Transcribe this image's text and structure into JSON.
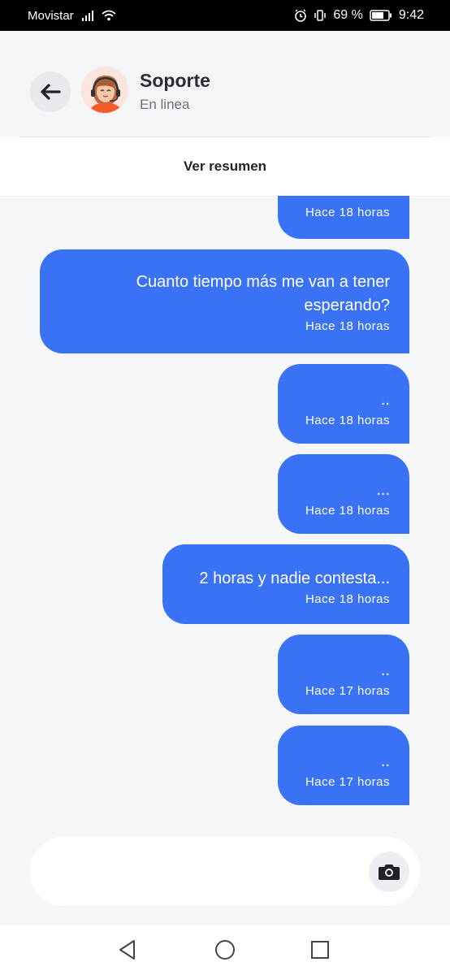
{
  "status_bar": {
    "carrier": "Movistar",
    "battery": "69 %",
    "time": "9:42"
  },
  "header": {
    "contact_name": "Soporte",
    "contact_status": "En linea",
    "summary_label": "Ver resumen"
  },
  "messages": [
    {
      "text": "",
      "time": "Hace 18 horas"
    },
    {
      "text": "Cuanto tiempo más me van a tener esperando?",
      "time": "Hace 18 horas"
    },
    {
      "text": "..",
      "time": "Hace 18 horas"
    },
    {
      "text": "...",
      "time": "Hace 18 horas"
    },
    {
      "text": "2 horas y nadie contesta...",
      "time": "Hace 18 horas"
    },
    {
      "text": "..",
      "time": "Hace 17 horas"
    },
    {
      "text": "..",
      "time": "Hace 17 horas"
    }
  ],
  "composer": {
    "value": "",
    "placeholder": ""
  },
  "colors": {
    "bubble": "#3a72f6",
    "background": "#f5f6f8"
  },
  "icons": [
    "back-arrow-icon",
    "camera-icon",
    "nav-back-icon",
    "nav-home-icon",
    "nav-recents-icon"
  ]
}
